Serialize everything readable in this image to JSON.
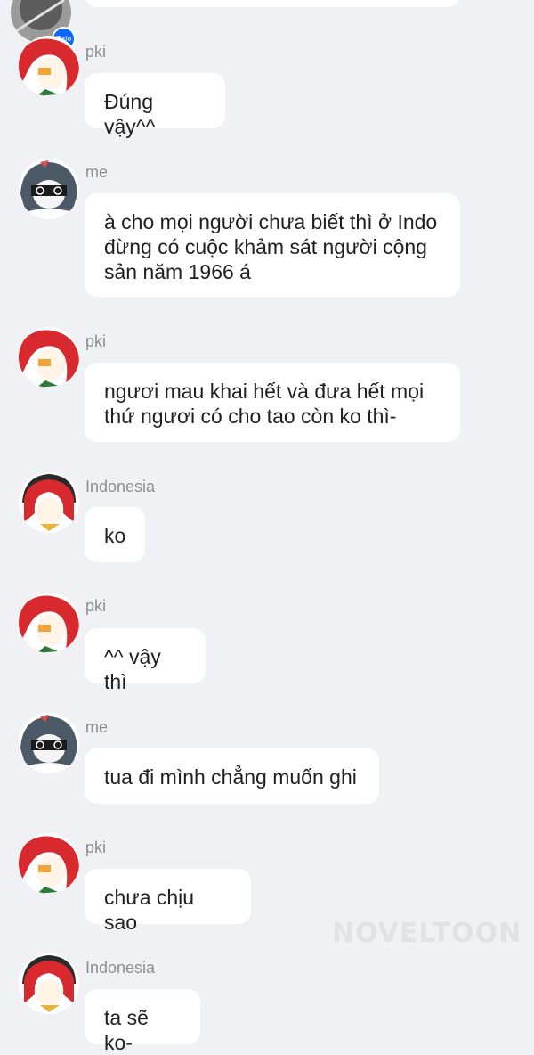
{
  "app": {
    "badge": "Zalo",
    "watermark": "NOVELTOON",
    "accent": "#0a68ff"
  },
  "messages": [
    {
      "sender": "pki",
      "text": "Đúng vậy^^",
      "avatar": "red-hair-avatar"
    },
    {
      "sender": "me",
      "text": "à cho mọi người chưa biết thì ở Indo đừng có cuộc khảm sát người cộng sản năm 1966 á",
      "avatar": "dark-hair-avatar"
    },
    {
      "sender": "pki",
      "text": "ngươi mau khai hết và đưa hết mọi thứ ngươi có cho tao còn ko thì-",
      "avatar": "red-hair-avatar"
    },
    {
      "sender": "Indonesia",
      "text": "ko",
      "avatar": "red-hat-avatar"
    },
    {
      "sender": "pki",
      "text": "^^ vậy thì",
      "avatar": "red-hair-avatar"
    },
    {
      "sender": "me",
      "text": "tua đi mình chẳng muốn ghi",
      "avatar": "dark-hair-avatar"
    },
    {
      "sender": "pki",
      "text": "chưa chịu sao",
      "avatar": "red-hair-avatar"
    },
    {
      "sender": "Indonesia",
      "text": "ta sẽ ko-",
      "avatar": "red-hat-avatar"
    }
  ]
}
